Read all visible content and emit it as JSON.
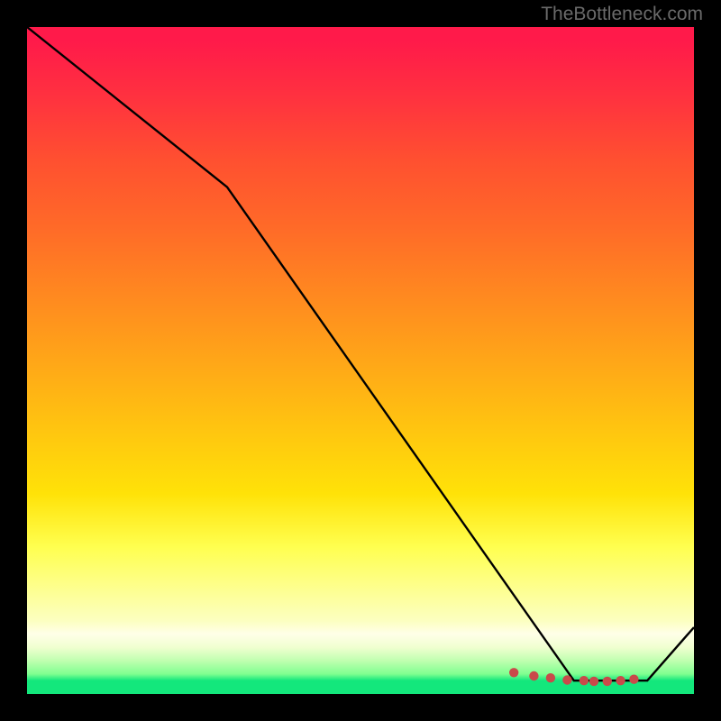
{
  "attribution": "TheBottleneck.com",
  "chart_data": {
    "type": "line",
    "title": "",
    "xlabel": "",
    "ylabel": "",
    "xlim": [
      0,
      100
    ],
    "ylim": [
      0,
      100
    ],
    "series": [
      {
        "name": "curve",
        "x": [
          0,
          30,
          82,
          93,
          100
        ],
        "values": [
          100,
          76,
          2,
          2,
          10
        ]
      }
    ],
    "markers": {
      "x": [
        73,
        76,
        78.5,
        81,
        83.5,
        85,
        87,
        89,
        91
      ],
      "y": [
        3.2,
        2.7,
        2.4,
        2.1,
        2.0,
        1.9,
        1.9,
        2.0,
        2.2
      ]
    },
    "gradient_direction": "vertical",
    "gradient_stops": [
      {
        "pct": 0,
        "color": "#ff1a4a"
      },
      {
        "pct": 50,
        "color": "#ffa618"
      },
      {
        "pct": 78,
        "color": "#ffff50"
      },
      {
        "pct": 98,
        "color": "#13e77c"
      }
    ]
  }
}
